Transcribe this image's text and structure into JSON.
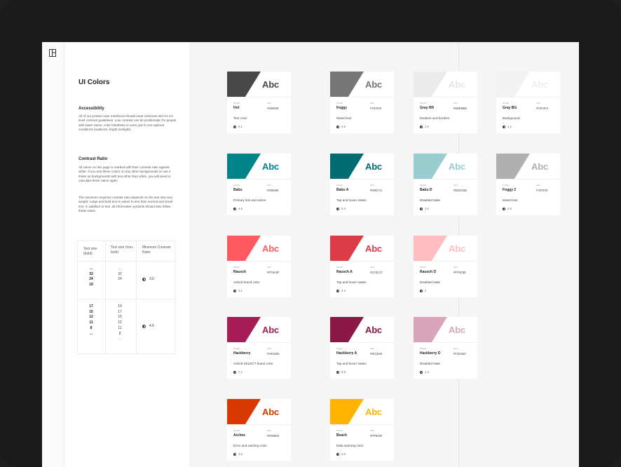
{
  "sidebar": {
    "title": "UI Colors",
    "accessibility": {
      "heading": "Accessibility",
      "body": "All of our product user interfaces should meet minimum WCAG AA level contrast guidelines. Low contrast can be problematic for people with lower vision, color blindness or even just in non-optimal conditions (outdoors, bright sunlight)."
    },
    "contrast": {
      "heading": "Contrast Ratio",
      "body1": "All colors on this page is marked with their contrast ratio against white. If you use these colors on any other backgrounds or use it these as backgrounds with text other than white, you will need to calculate these ratios again.",
      "body2": "The minimum required contrast ratio depends on the text size and weight. Large and bold text is easier to see than normal and small text. In addition to text, all informative symbols should also follow these ratios."
    },
    "table": {
      "headers": [
        "Text size (bold)",
        "Text size (non-bold)",
        "Minimum Contrast Ratio"
      ],
      "rows": [
        {
          "bold": [
            "...",
            "32",
            "24",
            "19"
          ],
          "regular": [
            "...",
            "32",
            "24"
          ],
          "ratio": "3.0"
        },
        {
          "bold": [
            "17",
            "15",
            "12",
            "11",
            "8",
            "..."
          ],
          "regular": [
            "19",
            "17",
            "15",
            "12",
            "11",
            "8",
            "..."
          ],
          "ratio": "4.5"
        }
      ]
    }
  },
  "cards": [
    {
      "name": "Hof",
      "hex": "#484848",
      "desc": "Text color",
      "ratio": "9.1",
      "color": "#484848",
      "text_color": "#484848"
    },
    {
      "name": "Foggy",
      "hex": "#767676",
      "desc": "Muted text",
      "ratio": "4.5",
      "color": "#767676",
      "text_color": "#767676"
    },
    {
      "name": "Gray HR",
      "hex": "#EBEBEB",
      "desc": "Dividers and borders",
      "ratio": "1.5",
      "color": "#EBEBEB",
      "text_color": "#E4E4E4"
    },
    {
      "name": "Gray BG",
      "hex": "#F2F2F2",
      "desc": "Background",
      "ratio": "1.1",
      "color": "#F2F2F2",
      "text_color": "#EDEDED"
    },
    {
      "name": "Babu",
      "hex": "#008489",
      "desc": "Primary link and action",
      "ratio": "4.6",
      "color": "#008489",
      "text_color": "#008489"
    },
    {
      "name": "Babu A",
      "hex": "#006C72",
      "desc": "Tap and hover states",
      "ratio": "5.4",
      "color": "#006C72",
      "text_color": "#006C72"
    },
    {
      "name": "Babu D",
      "hex": "#B2DADB",
      "desc": "Disabled state",
      "ratio": "1.5",
      "color": "#99CDD0",
      "text_color": "#99CDD0"
    },
    {
      "name": "Foggy 2",
      "hex": "#767676",
      "desc": "Muted text",
      "ratio": "4.5",
      "color": "#B0B0B0",
      "text_color": "#B0B0B0"
    },
    {
      "name": "Rausch",
      "hex": "#FF5A5F",
      "desc": "Airbnb brand color",
      "ratio": "3.1",
      "color": "#FF5A5F",
      "text_color": "#FF5A5F"
    },
    {
      "name": "Rausch A",
      "hex": "#CF3C47",
      "desc": "Tap and hover states",
      "ratio": "4.3",
      "color": "#DC3B48",
      "text_color": "#DC3B48"
    },
    {
      "name": "Rausch D",
      "hex": "#FF9C9E",
      "desc": "Disabled state",
      "ratio": "2",
      "color": "#FFBDBF",
      "text_color": "#FFBDBF"
    },
    {
      "name": "Hackberry",
      "hex": "#A61D55",
      "desc": "Airbnb SELECT brand color",
      "ratio": "7.2",
      "color": "#A61D55",
      "text_color": "#A61D55"
    },
    {
      "name": "Hackberry A",
      "hex": "#8C1848",
      "desc": "Tap and hover states",
      "ratio": "6.8",
      "color": "#8C1848",
      "text_color": "#8C1848"
    },
    {
      "name": "Hackberry D",
      "hex": "#F2D3E0",
      "desc": "Disabled state",
      "ratio": "1.4",
      "color": "#DAA5BB",
      "text_color": "#DAA5BB"
    },
    {
      "name": "Arches",
      "hex": "#D93900",
      "desc": "Error and warning color",
      "ratio": "4.6",
      "color": "#D93900",
      "text_color": "#D93900"
    },
    {
      "name": "Beach",
      "hex": "#FFB400",
      "desc": "Data warning color",
      "ratio": "1.8",
      "color": "#FFB400",
      "text_color": "#FFB400"
    }
  ],
  "card_labels": {
    "abc": "Abc",
    "name_label": "NAME",
    "hex_label": "HEX"
  }
}
